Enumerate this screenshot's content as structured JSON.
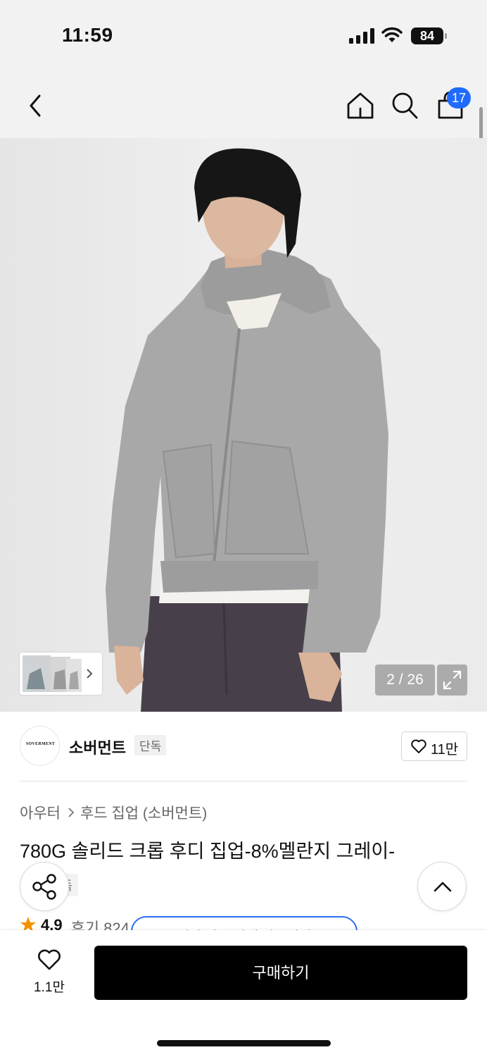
{
  "status_bar": {
    "time": "11:59",
    "battery": "84"
  },
  "nav": {
    "cart_count": "17"
  },
  "gallery": {
    "counter": "2 / 26"
  },
  "brand": {
    "name": "소버먼트",
    "tag": "단독",
    "logo_text": "SOVERMENT",
    "likes": "11만"
  },
  "breadcrumb": {
    "category": "아우터",
    "subcategory": "후드 집업 (소버먼트)"
  },
  "product": {
    "title": "780G 솔리드 크롭 후디 집업-8%멜란지 그레이-",
    "tag": "단독",
    "rating": "4.9",
    "reviews": "후기 824",
    "promo": "무신사 다른 가게 상품이에요"
  },
  "bottom_bar": {
    "wish_count": "1.1만",
    "buy_label": "구매하기"
  },
  "colors": {
    "accent_blue": "#1f6bff",
    "buy_button": "#000000",
    "star": "#f39200"
  }
}
